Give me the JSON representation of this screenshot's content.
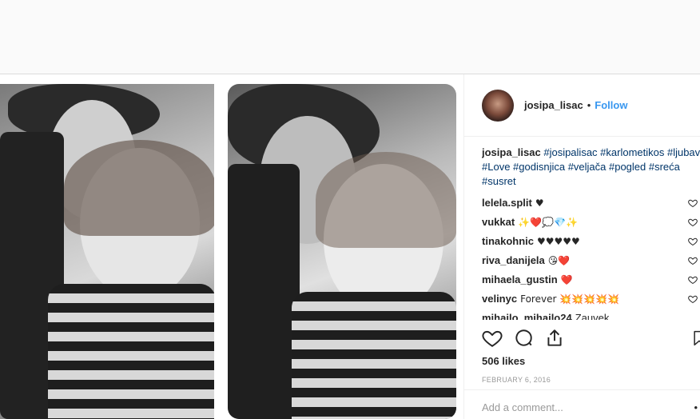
{
  "post": {
    "username": "josipa_lisac",
    "separator": "•",
    "follow_label": "Follow",
    "caption_user": "josipa_lisac",
    "caption_tags": "#josipalisac #karlometikos #ljubav #Love #godisnjica #veljača #pogled #sreća #susret",
    "comments": [
      {
        "user": "lelela.split",
        "text": "♥"
      },
      {
        "user": "vukkat",
        "text": "✨❤️💭💎✨"
      },
      {
        "user": "tinakohnic",
        "text": "♥♥♥♥♥"
      },
      {
        "user": "riva_danijela",
        "text": "😘❤️"
      },
      {
        "user": "mihaela_gustin",
        "text": "❤️"
      },
      {
        "user": "velinyc",
        "text": "Forever 💥💥💥💥💥"
      },
      {
        "user": "mihailo_mihailo24",
        "text": "Zauvek"
      }
    ],
    "likes": "506 likes",
    "date": "FEBRUARY 6, 2016",
    "add_comment_placeholder": "Add a comment...",
    "more_label": "•"
  },
  "icons": {
    "like": "heart-icon",
    "comment": "comment-icon",
    "share": "share-icon",
    "save": "bookmark-icon"
  },
  "colors": {
    "link": "#3897f0",
    "hashtag": "#003569",
    "heart": "#e0245e"
  }
}
